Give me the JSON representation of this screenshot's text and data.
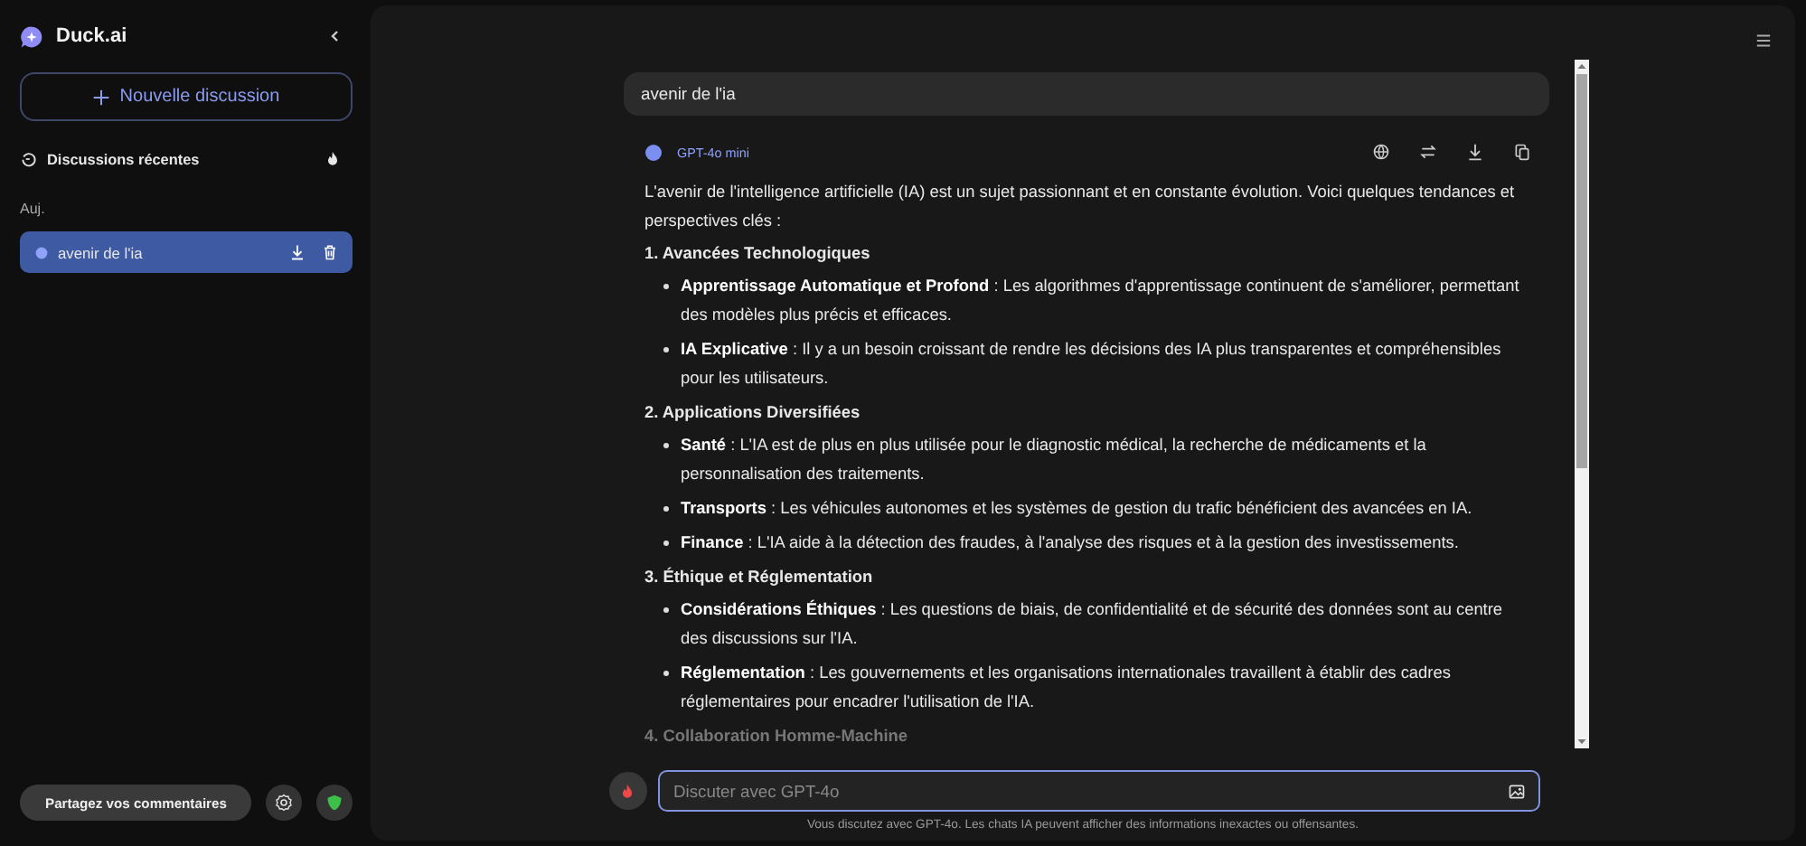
{
  "sidebar": {
    "brand": "Duck.ai",
    "new_chat_button": "Nouvelle discussion",
    "recent_heading": "Discussions récentes",
    "group_label": "Auj.",
    "chats": [
      {
        "title": "avenir de l'ia",
        "selected": true
      }
    ],
    "feedback_button": "Partagez vos commentaires"
  },
  "chat": {
    "user_message": "avenir de l'ia",
    "model_name": "GPT-4o mini",
    "response": [
      {
        "kind": "paragraph",
        "text": "L'avenir de l'intelligence artificielle (IA) est un sujet passionnant et en constante évolution. Voici quelques tendances et perspectives clés :"
      },
      {
        "kind": "heading",
        "text": "1. Avancées Technologiques"
      },
      {
        "kind": "bullet",
        "text": "**Apprentissage Automatique et Profond** : Les algorithmes d'apprentissage continuent de s'améliorer, permettant des modèles plus précis et efficaces."
      },
      {
        "kind": "bullet",
        "text": "**IA Explicative** : Il y a un besoin croissant de rendre les décisions des IA plus transparentes et compréhensibles pour les utilisateurs."
      },
      {
        "kind": "heading",
        "text": "2. Applications Diversifiées"
      },
      {
        "kind": "bullet",
        "text": "**Santé** : L'IA est de plus en plus utilisée pour le diagnostic médical, la recherche de médicaments et la personnalisation des traitements."
      },
      {
        "kind": "bullet",
        "text": "**Transports** : Les véhicules autonomes et les systèmes de gestion du trafic bénéficient des avancées en IA."
      },
      {
        "kind": "bullet",
        "text": "**Finance** : L'IA aide à la détection des fraudes, à l'analyse des risques et à la gestion des investissements."
      },
      {
        "kind": "heading",
        "text": "3. Éthique et Réglementation"
      },
      {
        "kind": "bullet",
        "text": "**Considérations Éthiques** : Les questions de biais, de confidentialité et de sécurité des données sont au centre des discussions sur l'IA."
      },
      {
        "kind": "bullet",
        "text": "**Réglementation** : Les gouvernements et les organisations internationales travaillent à établir des cadres réglementaires pour encadrer l'utilisation de l'IA."
      },
      {
        "kind": "faded_heading",
        "text": "4. Collaboration Homme-Machine"
      }
    ]
  },
  "composer": {
    "placeholder": "Discuter avec GPT-4o"
  },
  "disclaimer": "Vous discutez avec GPT-4o. Les chats IA peuvent afficher des informations inexactes ou offensantes."
}
